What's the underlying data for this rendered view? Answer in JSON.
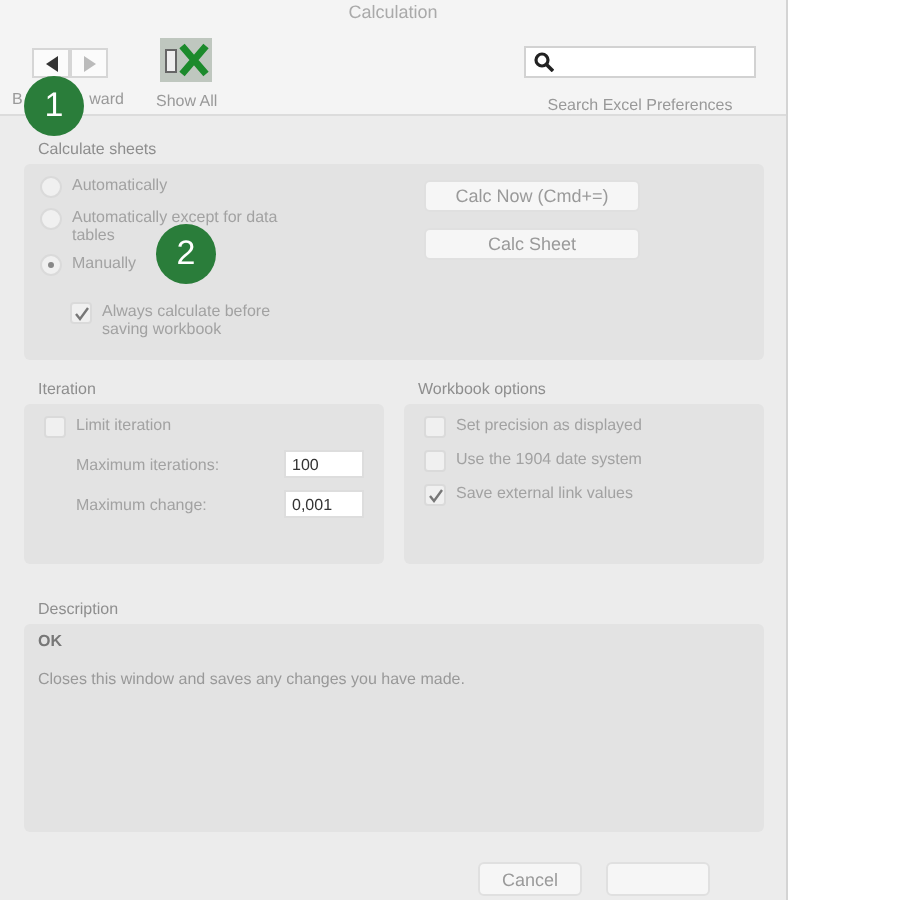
{
  "window": {
    "title": "Calculation"
  },
  "toolbar": {
    "nav_labels": [
      "B",
      "ward"
    ],
    "show_all_label": "Show All",
    "search": {
      "caption": "Search Excel Preferences"
    }
  },
  "annotations": [
    {
      "number": "1"
    },
    {
      "number": "2"
    }
  ],
  "calculate_sheets": {
    "title": "Calculate sheets",
    "options": [
      {
        "label": "Automatically",
        "selected": false
      },
      {
        "label": "Automatically except for data tables",
        "selected": false
      },
      {
        "label": "Manually",
        "selected": true
      }
    ],
    "save_check": {
      "label": "Always calculate before saving workbook",
      "checked": true
    },
    "buttons": [
      "Calc Now (Cmd+=)",
      "Calc Sheet"
    ]
  },
  "iteration": {
    "title": "Iteration",
    "limit": {
      "label": "Limit iteration",
      "checked": false
    },
    "fields": [
      {
        "label": "Maximum iterations:",
        "value": "100"
      },
      {
        "label": "Maximum change:",
        "value": "0,001"
      }
    ]
  },
  "workbook_options": {
    "title": "Workbook options",
    "items": [
      {
        "label": "Set precision as displayed",
        "checked": false
      },
      {
        "label": "Use the 1904 date system",
        "checked": false
      },
      {
        "label": "Save external link values",
        "checked": true
      }
    ]
  },
  "description": {
    "title": "Description",
    "heading": "OK",
    "text": "Closes this window and saves any changes you have made."
  },
  "footer": {
    "buttons": [
      {
        "kind": "labeled",
        "label": "Cancel"
      },
      {
        "kind": "covered"
      }
    ]
  }
}
